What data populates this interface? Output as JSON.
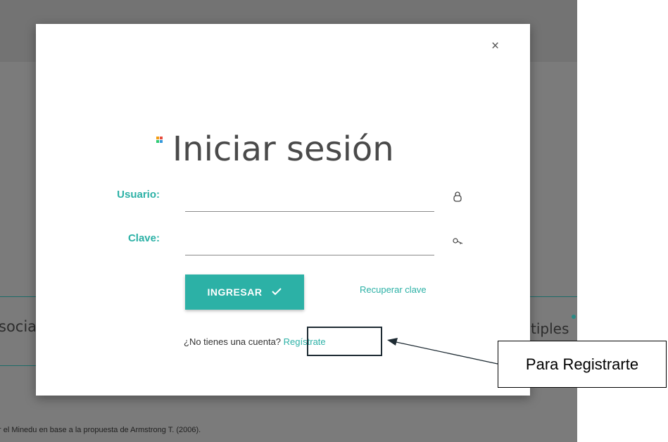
{
  "background": {
    "left_partial_text": "socia",
    "right_partial_text": "tiples",
    "footnote": "r el Minedu en base a la propuesta de Armstrong T. (2006)."
  },
  "modal": {
    "close_label": "×",
    "title": "Iniciar sesión",
    "logo_colors": [
      "#f39c12",
      "#e74c3c",
      "#2ecc71",
      "#3498db"
    ],
    "username": {
      "label": "Usuario:",
      "value": "",
      "icon": "user-icon"
    },
    "password": {
      "label": "Clave:",
      "value": "",
      "icon": "key-icon"
    },
    "submit_label": "INGRESAR",
    "submit_icon": "check-icon",
    "recover_label": "Recuperar clave",
    "register_prompt": "¿No tienes una cuenta?",
    "register_label": "Regístrate"
  },
  "annotation": {
    "callout_text": "Para Registrarte"
  },
  "colors": {
    "accent": "#2cb1a6",
    "overlay": "#7b7b7b",
    "annotation_border": "#1e2b33"
  }
}
